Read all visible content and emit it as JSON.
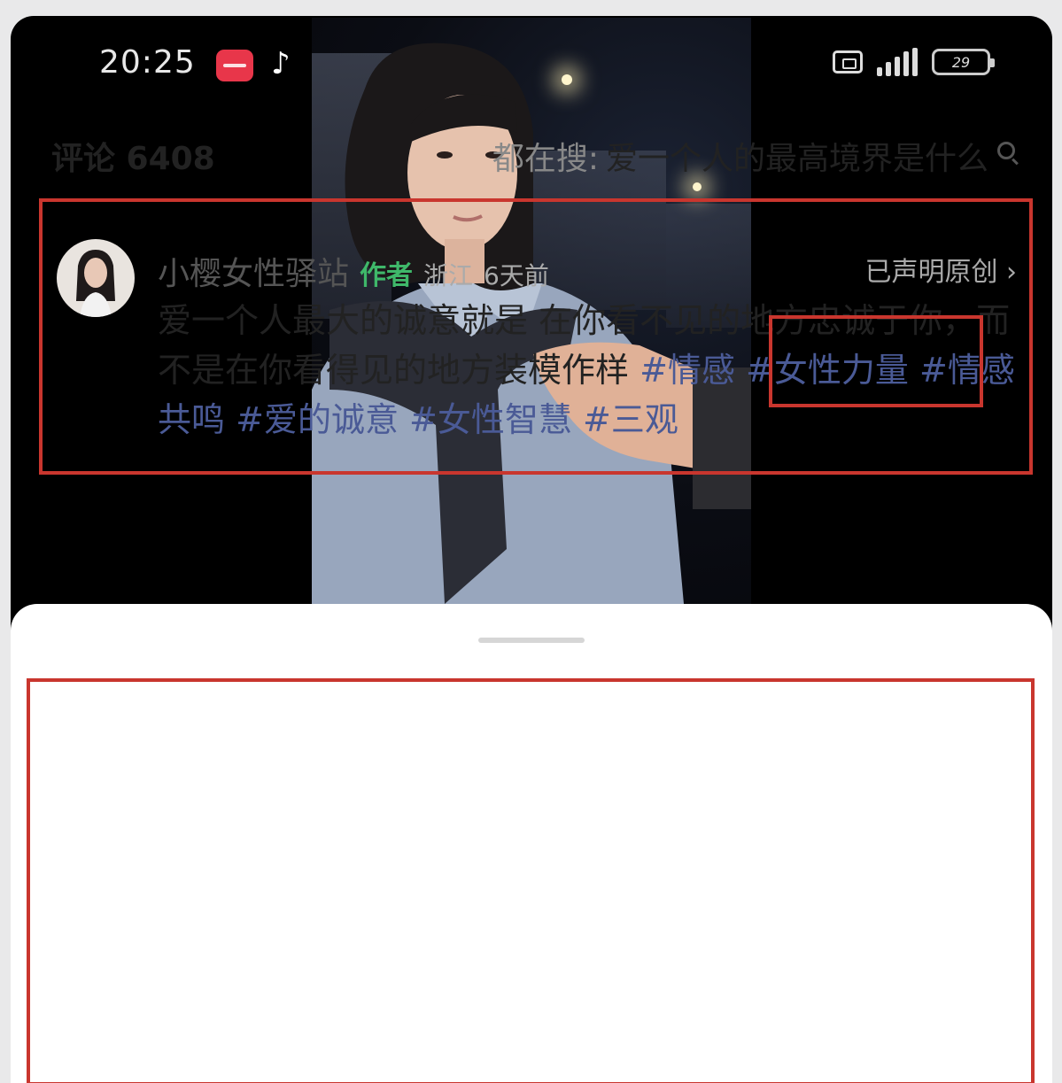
{
  "status_bar": {
    "time": "20:25",
    "battery": "29"
  },
  "icons": {
    "red_app": "app-icon",
    "tiktok": "tiktok-icon",
    "nfc": "nfc-icon",
    "signal": "signal-icon",
    "battery": "battery-icon"
  },
  "comments": {
    "title": "评论 6408",
    "search_prefix": "都在搜:",
    "search_query": "爱一个人的最高境界是什么",
    "item": {
      "author": "小樱女性驿站",
      "author_tag": "作者",
      "location": "浙江",
      "time": "6天前",
      "claim": "已声明原创",
      "text": "爱一个人最大的诚意就是 在你看不见的地方忠诚于你，而不是在你看得见的地方装模作样",
      "tags": [
        "#情感",
        "#女性力量",
        "#情感共鸣",
        "#爱的诚意",
        "#女性智慧",
        "#三观"
      ]
    }
  },
  "colors": {
    "highlight_border": "#c9362e",
    "author_tag": "#3fb86a",
    "hashtag": "#4a5a96"
  }
}
